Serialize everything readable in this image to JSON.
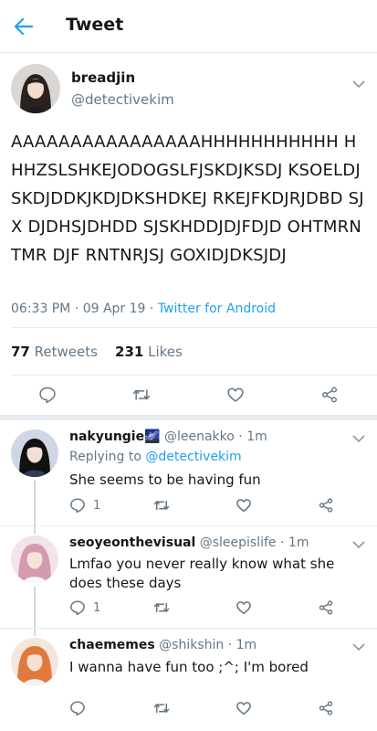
{
  "header": {
    "title": "Tweet"
  },
  "tweet": {
    "name": "breadjin",
    "handle": "@detectivekim",
    "text": "AAAAAAAAAAAAAAAAHHHHHHHHHHH HHHZSLSHKEJODOGSLFJSKDJKSDJ KSOELDJSKDJDDKJKDJDKSHDKEJ RKEJFKDJRJDBD SJX DJDHSJDHDD SJSKHDDJDJFDJD OHTMRNTMR DJF RNTNRJSJ GOXIDJDKSJDJ",
    "time": "06:33 PM",
    "date": "09 Apr 19",
    "client": "Twitter for Android",
    "retweets": "77",
    "retweets_label": "Retweets",
    "likes": "231",
    "likes_label": "Likes"
  },
  "replies": [
    {
      "name": "nakyungie🌌",
      "handle": "@leenakko",
      "time": "1m",
      "replying_prefix": "Replying to",
      "replying_to": "@detectivekim",
      "text": "She seems to be having fun",
      "reply_count": "1",
      "avatar_color": "#2f3b57"
    },
    {
      "name": "seoyeonthevisual",
      "handle": "@sleepislife",
      "time": "1m",
      "text": "Lmfao you never really know what she does these days",
      "reply_count": "1",
      "avatar_color": "#e8b9c9"
    },
    {
      "name": "chaememes",
      "handle": "@shikshin",
      "time": "1m",
      "text": "I wanna have fun too ;^; I'm bored",
      "avatar_color": "#e8844a"
    }
  ],
  "icons": {
    "back": "arrow-left-icon",
    "reply": "reply-icon",
    "retweet": "retweet-icon",
    "like": "heart-icon",
    "share": "share-icon",
    "more": "chevron-down-icon"
  },
  "colors": {
    "accent": "#1da1f2",
    "secondary_text": "#657786",
    "divider": "#e6ecf0"
  }
}
